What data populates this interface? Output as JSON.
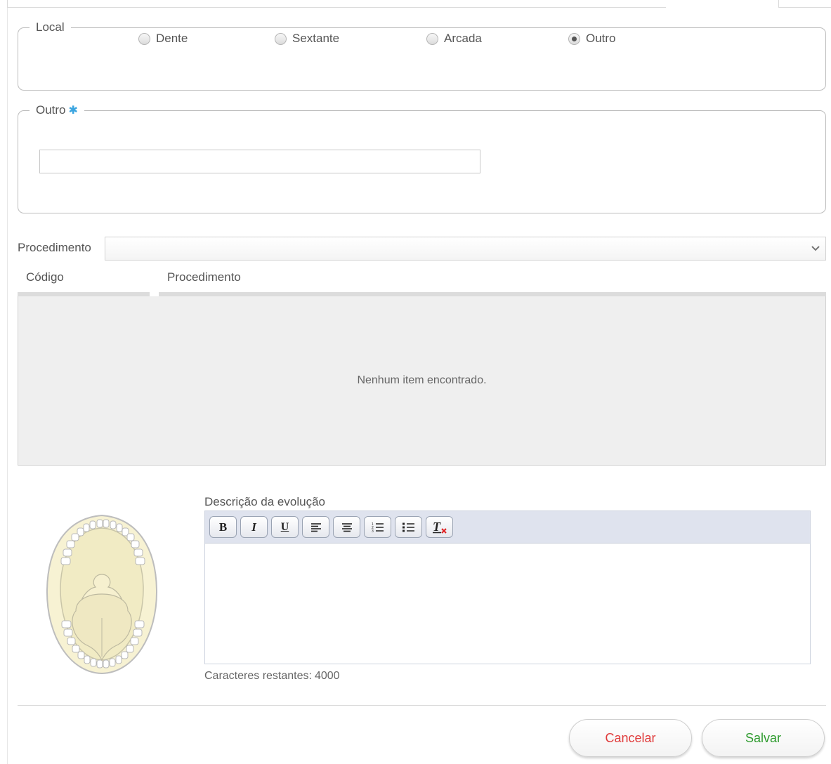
{
  "local": {
    "legend": "Local",
    "options": [
      "Dente",
      "Sextante",
      "Arcada",
      "Outro"
    ],
    "selected": "Outro"
  },
  "outro": {
    "legend": "Outro",
    "required_mark": "✱",
    "value": ""
  },
  "procedimento": {
    "label": "Procedimento",
    "value": ""
  },
  "table": {
    "columns": [
      "Código",
      "Procedimento"
    ],
    "empty_message": "Nenhum item encontrado."
  },
  "descricao": {
    "label": "Descrição da evolução",
    "toolbar": [
      "bold",
      "italic",
      "underline",
      "align-left",
      "align-center",
      "ordered-list",
      "unordered-list",
      "remove-format"
    ],
    "chars_label": "Caracteres restantes:",
    "chars_remaining": "4000"
  },
  "buttons": {
    "cancel": "Cancelar",
    "save": "Salvar"
  },
  "colors": {
    "cancel": "#e03b3b",
    "save": "#2e9b2e",
    "required": "#3ba5e0"
  }
}
